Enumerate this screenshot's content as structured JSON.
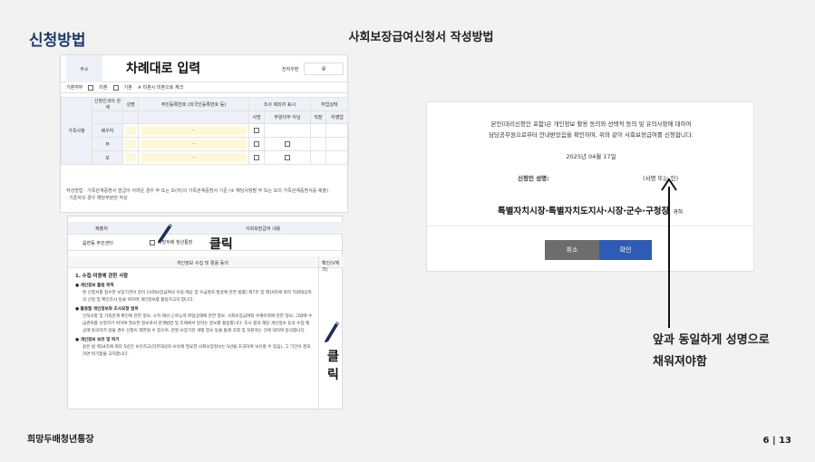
{
  "header": {
    "title": "신청방법",
    "subtitle": "사회보장급여신청서 작성방법"
  },
  "footer": {
    "org": "희망두배청년통장",
    "page": "6 | 13"
  },
  "form_top": {
    "address_label": "주소",
    "address_instruction": "차례대로 입력",
    "phone_label": "전자우편",
    "phone_value": "@",
    "married_label": "기혼여부",
    "married_options": [
      "미혼",
      "기혼",
      "※ 미혼시 미혼으로 체크"
    ],
    "family_label": "가족사항",
    "columns": [
      "신청인과의 관계",
      "성명",
      "주민등록번호 (외국인등록번호 등)",
      "조사 제외자 표시",
      "취업상태"
    ],
    "sub_columns": [
      "사망",
      "부양의무 아님",
      "직장",
      "자영업"
    ],
    "rows": [
      {
        "relation": "배우자",
        "id": "-"
      },
      {
        "relation": "부",
        "id": "-"
      },
      {
        "relation": "모",
        "id": "-"
      }
    ],
    "notes_label": "작성방법",
    "notes": [
      "· 가족관계증명서 발급이 어려운 경우 부 또는 모(자)의 가족관계증명서 기준 (※ 해당사항별 부 또는 모의 가족관계증명서를 제출)",
      "· 기준자의 경우 해당부분만 작성"
    ]
  },
  "form_bottom": {
    "head_left": "제출처",
    "head_right": "사회보장급여 내용",
    "org": "읍면동 주민센터",
    "org_item": "희망두배 청년통장",
    "click_label": "클릭",
    "consent_head": "개인정보 수집 및 활용 동의",
    "consent_confirm": "확인(V체크)",
    "section1": "1. 수집·이용에 관한 사항",
    "item1_title": "● 개인정보 활용 목적",
    "item1_body": "본 신청서를 접수한 보장기관이 장이 [사회보장급여의 이용·제공 및 수급권자 발굴에 관한 법률] 제7조 및 제19조에 따라 지원대상자의 선정 및 확인조사 등을 위하여 개인정보를 활용하고자 합니다.",
    "item2_title": "● 활용할 개인정보와 조사요청 범위",
    "item2_body": "인적사항 및 가족관계 확인에 관한 정보, 소득·재산·근로능력·취업상태에 관한 정보, 사회보장급여와 수혜이력에 관한 정보, 그밖에 수급권자를 선정하기 위하여 필요한 정보로서 관계법령 및 조례에서 정하는 정보를 활용합니다. 조사 결과 해당 개인정보 등의 수집·제공에 동의하지 않을 경우 신청이 제한될 수 있으며, 관할 보장기관 개별 정보 등을 통해 조회 및 처분하는 것에 대하여 동의합니다.",
    "item3_title": "● 개인정보 보유 및 파기",
    "item3_body": "같은 법 제34조에 따라 5년간 보유하고(리뷰대상자 보유에 필요한 사회보장정보는 5년을 초과하여 보유할 수 있음), 그 기간이 경과하면 파기함을 고지합니다.",
    "click_label2": "클릭"
  },
  "dialog": {
    "statement_line1": "본인(대리신청인 포함)은 개인정보 활용 동의와 선택적 동의 및 유의사항에 대하여",
    "statement_line2": "담당공무원으로부터 안내받았음을 확인하며, 위와 같이 사회보장급여를 신청합니다.",
    "date": "2025년 04월 17일",
    "signature_label": "신청인 성명:",
    "signature_value": "(서명 또는 인)",
    "recipient": "특별자치시장·특별자치도지사·시장·군수·구청장",
    "recipient_suffix": "귀하",
    "cancel_label": "취소",
    "ok_label": "확인"
  },
  "annotation": {
    "line1": "앞과 동일하게 성명으로",
    "line2": "채워져야함"
  },
  "colors": {
    "title": "#1f3a6e",
    "ok_button": "#2e5bb5",
    "cancel_button": "#6d6d6d",
    "input_highlight": "#fff8d6"
  }
}
